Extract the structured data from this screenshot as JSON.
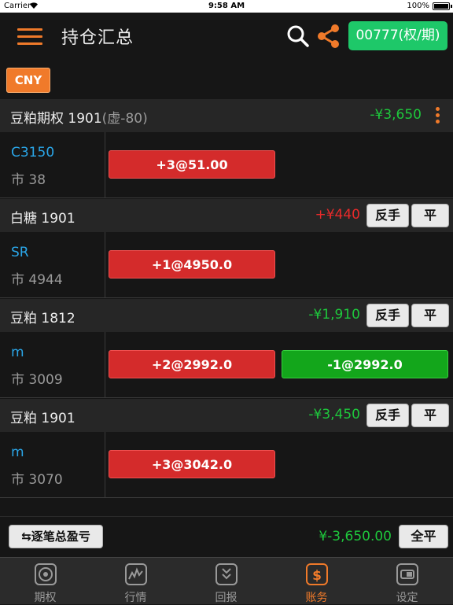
{
  "status_bar": {
    "carrier": "Carrier",
    "time": "9:58 AM",
    "battery": "100%"
  },
  "nav": {
    "title": "持仓汇总",
    "account_button": "00777(权/期)"
  },
  "currency": {
    "label": "CNY"
  },
  "positions": [
    {
      "name": "豆粕期权 1901",
      "virtual": "(虚-80)",
      "pnl": "-¥3,650",
      "pnl_sign": "neg",
      "code": "C3150",
      "market": "市 38",
      "trades": [
        {
          "label": "+3@51.00",
          "side": "long"
        }
      ],
      "actions": []
    },
    {
      "name": "白糖 1901",
      "virtual": "",
      "pnl": "+¥440",
      "pnl_sign": "pos",
      "code": "SR",
      "market": "市 4944",
      "trades": [
        {
          "label": "+1@4950.0",
          "side": "long"
        }
      ],
      "actions": [
        "反手",
        "平"
      ]
    },
    {
      "name": "豆粕 1812",
      "virtual": "",
      "pnl": "-¥1,910",
      "pnl_sign": "neg",
      "code": "m",
      "market": "市 3009",
      "trades": [
        {
          "label": "+2@2992.0",
          "side": "long"
        },
        {
          "label": "-1@2992.0",
          "side": "short"
        }
      ],
      "actions": [
        "反手",
        "平"
      ]
    },
    {
      "name": "豆粕 1901",
      "virtual": "",
      "pnl": "-¥3,450",
      "pnl_sign": "neg",
      "code": "m",
      "market": "市 3070",
      "trades": [
        {
          "label": "+3@3042.0",
          "side": "long"
        }
      ],
      "actions": [
        "反手",
        "平"
      ]
    }
  ],
  "summary": {
    "detail_button": "⇆逐笔总盈亏",
    "total_pnl": "¥-3,650.00",
    "close_all": "全平"
  },
  "tabs": [
    {
      "label": "期权",
      "icon": "target-icon",
      "active": false
    },
    {
      "label": "行情",
      "icon": "chart-icon",
      "active": false
    },
    {
      "label": "回报",
      "icon": "report-icon",
      "active": false
    },
    {
      "label": "账务",
      "icon": "dollar-icon",
      "active": true
    },
    {
      "label": "设定",
      "icon": "settings-icon",
      "active": false
    }
  ],
  "colors": {
    "accent": "#f07a2a",
    "gain": "#e82a2a",
    "loss": "#1ec83c",
    "account": "#1ec869",
    "code": "#2aa6e8"
  }
}
